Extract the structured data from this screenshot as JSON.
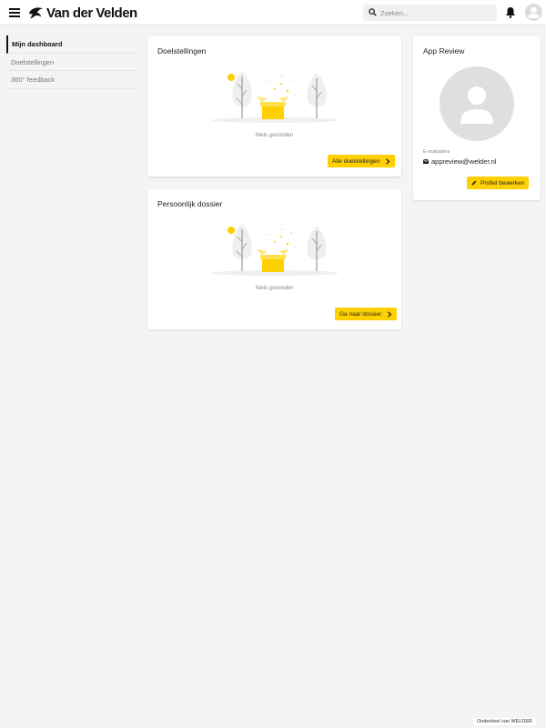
{
  "header": {
    "brand": "Van der Velden",
    "search_placeholder": "Zoeken..."
  },
  "sidebar": {
    "items": [
      {
        "label": "Mijn dashboard",
        "active": true
      },
      {
        "label": "Doelstellingen",
        "active": false
      },
      {
        "label": "360° feedback",
        "active": false
      }
    ]
  },
  "goals_card": {
    "title": "Doelstellingen",
    "empty_text": "Niets gevonden",
    "button_label": "Alle doelstellingen"
  },
  "dossier_card": {
    "title": "Persoonlijk dossier",
    "empty_text": "Niets gevonden",
    "button_label": "Ga naar dossier"
  },
  "profile": {
    "title": "App Review",
    "email_label": "E-mailadres",
    "email": "appreview@welder.nl",
    "edit_button_label": "Profiel bewerken"
  },
  "footer": {
    "text": "Onderdeel van WELDER"
  },
  "colors": {
    "accent": "#ffd000",
    "background": "#f4f4f4"
  }
}
